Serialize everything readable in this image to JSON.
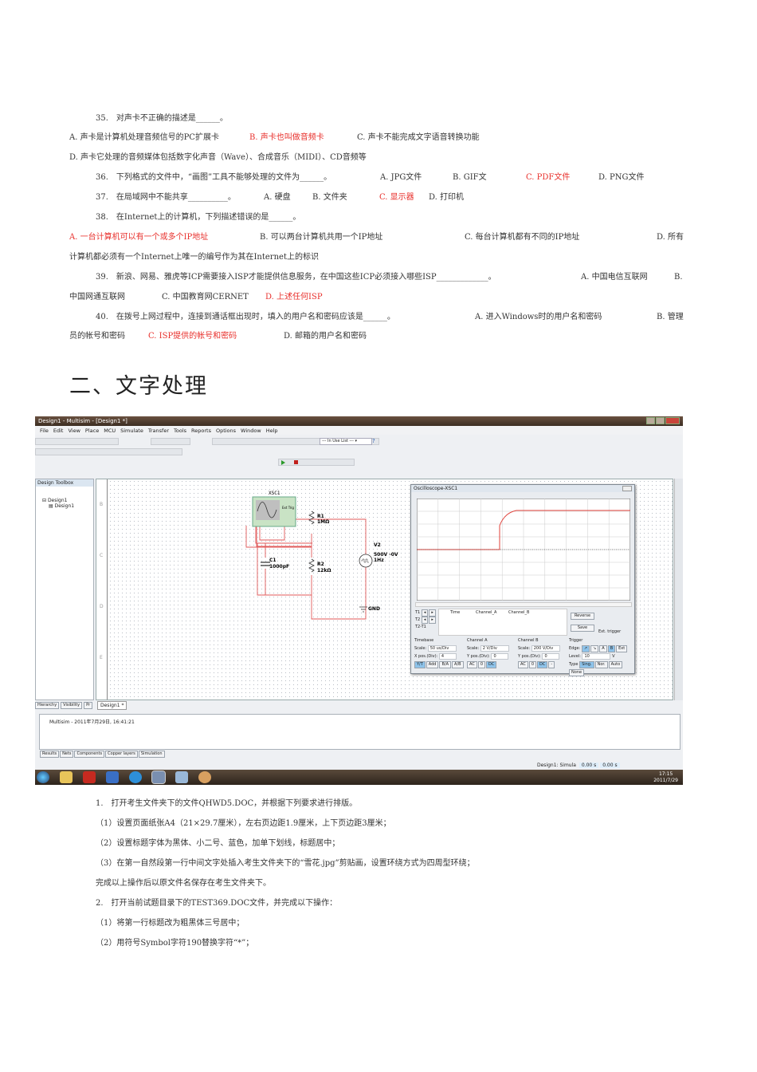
{
  "q35": {
    "stem": "35.　对声卡不正确的描述是______。",
    "a": "A. 声卡是计算机处理音频信号的PC扩展卡",
    "b": "B. 声卡也叫做音频卡",
    "c": "C. 声卡不能完成文字语音转换功能",
    "d": "D. 声卡它处理的音频媒体包括数字化声音（Wave）、合成音乐（MIDI）、CD音频等"
  },
  "q36": {
    "stem": "36.　下列格式的文件中，“画图”工具不能够处理的文件为______。",
    "a": "A. JPG文件",
    "b": "B. GIF文",
    "c": "C. PDF文件",
    "d": "D. PNG文件"
  },
  "q37": {
    "stem": "37.　在局域网中不能共享__________。",
    "a": "A. 硬盘",
    "b": "B. 文件夹",
    "c": "C. 显示器",
    "d": "D. 打印机"
  },
  "q38": {
    "stem": "38.　在Internet上的计算机，下列描述错误的是______。",
    "a": "A. 一台计算机可以有一个或多个IP地址",
    "b": "B. 可以两台计算机共用一个IP地址",
    "c": "C. 每台计算机都有不同的IP地址",
    "d1": "D. 所有",
    "d2": "计算机都必须有一个Internet上唯一的编号作为其在Internet上的标识"
  },
  "q39": {
    "stem": "39.　新浪、网易、雅虎等ICP需要接入ISP才能提供信息服务，在中国这些ICP必须接入哪些ISP_____________。",
    "a": "A. 中国电信互联网",
    "b1": "B.",
    "b2": "中国网通互联网",
    "c": "C. 中国教育网CERNET",
    "d": "D. 上述任何ISP"
  },
  "q40": {
    "stem": "40.　在拨号上网过程中，连接到通话框出现时，填入的用户名和密码应该是______。",
    "a": "A. 进入Windows时的用户名和密码",
    "b1": "B. 管理",
    "b2": "员的帐号和密码",
    "c": "C. ISP提供的帐号和密码",
    "d": "D. 邮箱的用户名和密码"
  },
  "section_heading": "二、文字处理",
  "app": {
    "title": "Design1 - Multisim - [Design1 *]",
    "menu": [
      "File",
      "Edit",
      "View",
      "Place",
      "MCU",
      "Simulate",
      "Transfer",
      "Tools",
      "Reports",
      "Options",
      "Window",
      "Help"
    ],
    "in_use_list": "--- In Use List ---",
    "toolbox_title": "Design Toolbox",
    "tree": [
      "Design1",
      "Design1"
    ],
    "ruler": [
      "B",
      "C",
      "D",
      "E"
    ],
    "circuit": {
      "scope": "XSC1",
      "r1": "R1",
      "r1v": "1MΩ",
      "r2": "R2",
      "r2v": "12kΩ",
      "c1": "C1",
      "c1v": "1000pF",
      "v2": "V2",
      "v2v": "500V -0V",
      "v2f": "1Hz",
      "gnd": "GND",
      "ext": "Ext Trig"
    },
    "scope": {
      "title": "Oscilloscope-XSC1",
      "cols": [
        "Time",
        "Channel_A",
        "Channel_B"
      ],
      "rows": [
        "T1",
        "T2",
        "T2-T1"
      ],
      "reverse": "Reverse",
      "save": "Save",
      "ext_trigger": "Ext. trigger",
      "timebase": {
        "label": "Timebase",
        "scale_l": "Scale:",
        "scale": "50 us/Div",
        "pos_l": "X pos.(Div):",
        "pos": "4",
        "modes": [
          "Y/T",
          "Add",
          "B/A",
          "A/B"
        ]
      },
      "cha": {
        "label": "Channel A",
        "scale_l": "Scale:",
        "scale": "2  V/Div",
        "pos_l": "Y pos.(Div):",
        "pos": "0",
        "coup": [
          "AC",
          "0",
          "DC"
        ]
      },
      "chb": {
        "label": "Channel B",
        "scale_l": "Scale:",
        "scale": "200  V/Div",
        "pos_l": "Y pos.(Div):",
        "pos": "0",
        "coup": [
          "AC",
          "0",
          "DC",
          "-"
        ]
      },
      "trigger": {
        "label": "Trigger",
        "edge_l": "Edge:",
        "edges": [
          "↗",
          "↘",
          "A",
          "B",
          "Ext"
        ],
        "level_l": "Level:",
        "level": "10",
        "unit": "V",
        "type_l": "Type",
        "types": [
          "Sing.",
          "Nor.",
          "Auto",
          "None"
        ]
      }
    },
    "panel_tabs": [
      "Hierarchy",
      "Visibility",
      "Pr"
    ],
    "doc_tab": "Design1 *",
    "log": "Multisim  -  2011年7月29日, 16:41:21",
    "result_tabs": [
      "Results",
      "Nets",
      "Components",
      "Copper layers",
      "Simulation"
    ],
    "status": "Design1: Simula",
    "status_vals": [
      "0.00 s",
      "0.00 s"
    ],
    "clock_time": "17:15",
    "clock_date": "2011/7/29"
  },
  "tasks": {
    "l1": "1.　打开考生文件夹下的文件QHWD5.DOC，并根据下列要求进行排版。",
    "l2": "（1）设置页面纸张A4（21×29.7厘米），左右页边距1.9厘米，上下页边距3厘米；",
    "l3": "（2）设置标题字体为黑体、小二号、蓝色，加单下划线，标题居中；",
    "l4": "（3）在第一自然段第一行中间文字处插入考生文件夹下的“雪花.jpg”剪贴画，设置环绕方式为四周型环绕；",
    "l5": "完成以上操作后以原文件名保存在考生文件夹下。",
    "l6": "2.　打开当前试题目录下的TEST369.DOC文件，并完成以下操作：",
    "l7": "（1）将第一行标题改为粗黑体三号居中；",
    "l8": "（2）用符号Symbol字符190替换字符“*”；"
  }
}
